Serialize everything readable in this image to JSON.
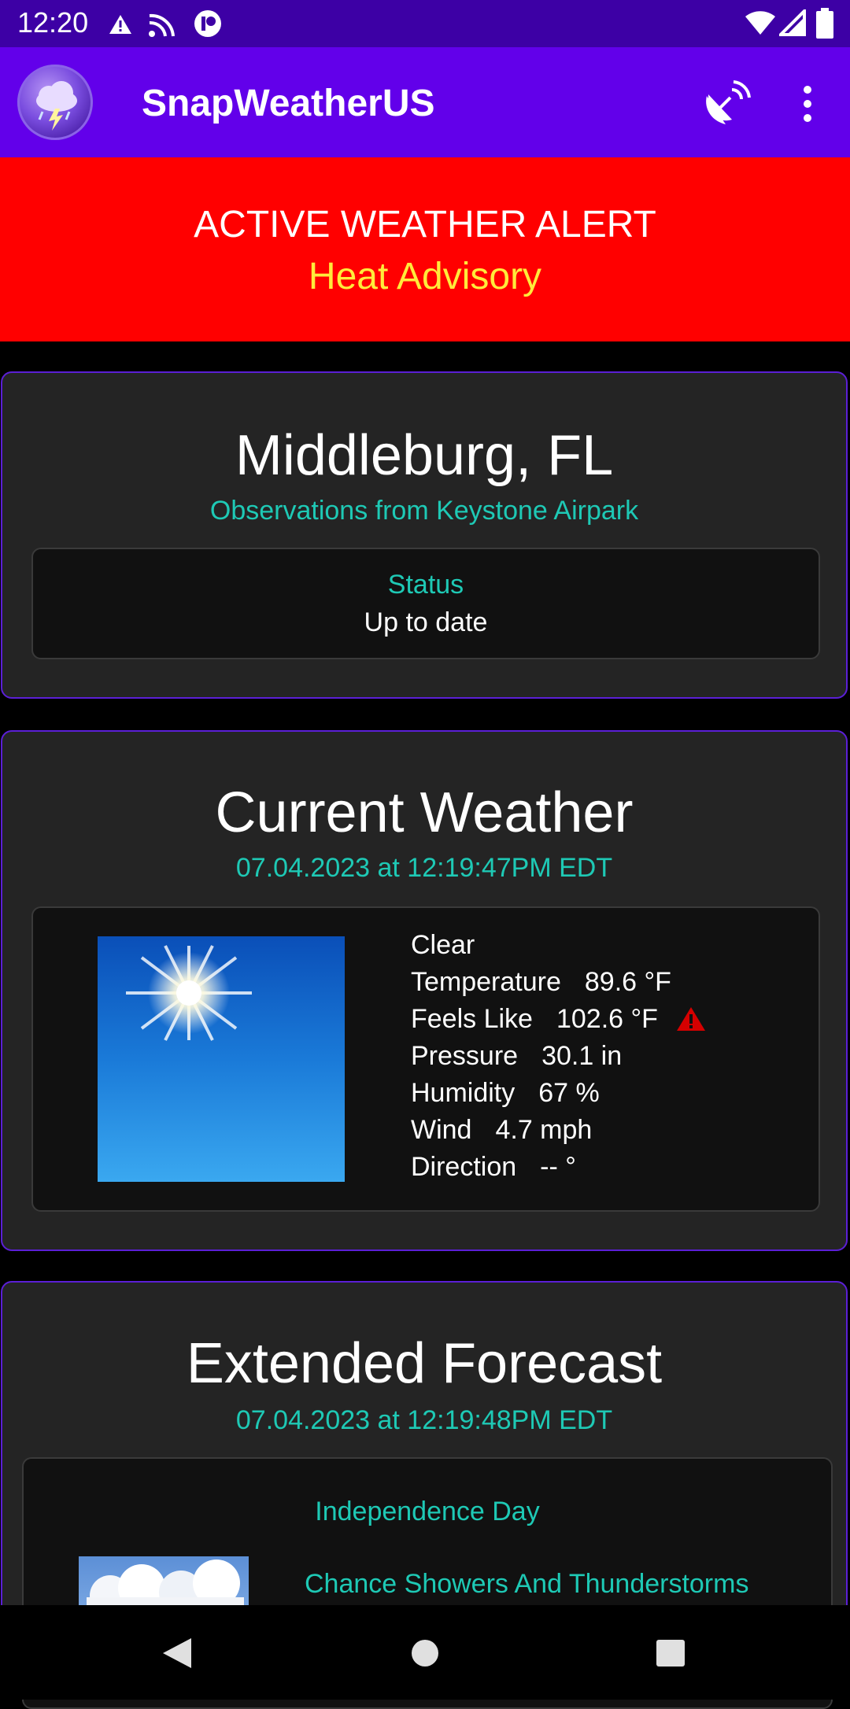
{
  "status_bar": {
    "time": "12:20",
    "left_icons": [
      "alert-triangle-icon",
      "cast-icon",
      "notification-app-icon"
    ],
    "right_icons": [
      "wifi-icon",
      "signal-icon",
      "battery-icon"
    ]
  },
  "app_bar": {
    "title": "SnapWeatherUS",
    "logo_icon": "storm-cloud-logo-icon",
    "actions": [
      "radar-dish-icon",
      "overflow-menu-icon"
    ]
  },
  "alert": {
    "heading": "ACTIVE WEATHER ALERT",
    "type": "Heat Advisory"
  },
  "location_card": {
    "city": "Middleburg, FL",
    "observations": "Observations from Keystone Airpark",
    "status_label": "Status",
    "status_value": "Up to date"
  },
  "current_weather": {
    "title": "Current Weather",
    "timestamp": "07.04.2023 at 12:19:47PM EDT",
    "condition": "Clear",
    "rows": [
      {
        "label": "Temperature",
        "value": "89.6 °F"
      },
      {
        "label": "Feels Like",
        "value": "102.6 °F"
      },
      {
        "label": "Pressure",
        "value": "30.1 in"
      },
      {
        "label": "Humidity",
        "value": "67 %"
      },
      {
        "label": "Wind",
        "value": "4.7 mph"
      },
      {
        "label": "Direction",
        "value": "-- °"
      }
    ],
    "feels_like_icon": "warning-triangle-icon"
  },
  "extended_forecast": {
    "title": "Extended Forecast",
    "timestamp": "07.04.2023 at 12:19:48PM EDT",
    "period": "Independence Day",
    "summary": "Chance Showers And Thunderstorms"
  },
  "nav_bar": {
    "icons": [
      "back-icon",
      "home-icon",
      "recents-icon"
    ]
  },
  "colors": {
    "status_bar": "#3d00a5",
    "app_bar": "#6200ea",
    "alert_bg": "#ff0000",
    "alert_type": "#ffeb3b",
    "accent": "#1ec9b5",
    "card_border": "#5b1fd6"
  }
}
